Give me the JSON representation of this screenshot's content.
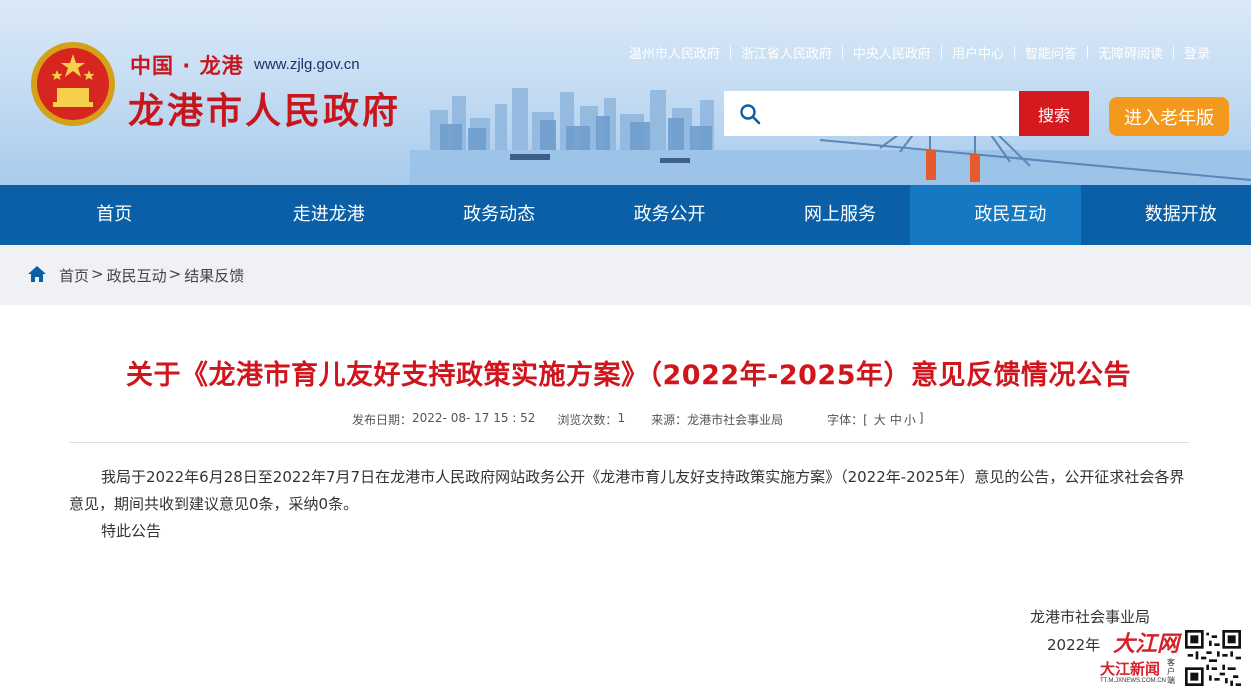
{
  "site": {
    "prefix": "中国 · 龙港",
    "url": "www.zjlg.gov.cn",
    "title": "龙港市人民政府"
  },
  "toplinks": [
    "温州市人民政府",
    "浙江省人民政府",
    "中央人民政府",
    "用户中心",
    "智能问答",
    "无障碍阅读",
    "登录"
  ],
  "search": {
    "placeholder": "",
    "button_label": "搜索"
  },
  "elder_button_label": "进入老年版",
  "nav": {
    "items": [
      "首页",
      "走进龙港",
      "政务动态",
      "政务公开",
      "网上服务",
      "政民互动",
      "数据开放"
    ],
    "active": "政民互动"
  },
  "breadcrumb": [
    "首页",
    "政民互动",
    "结果反馈"
  ],
  "article": {
    "title": "关于《龙港市育儿友好支持政策实施方案》（2022年-2025年）意见反馈情况公告",
    "meta": {
      "date_label": "发布日期：",
      "date": "2022- 08- 17 15 : 52",
      "views_label": "浏览次数：",
      "views": "1",
      "source_label": "来源：",
      "source": "龙港市社会事业局",
      "font_label": "字体：[",
      "font_large": "大",
      "font_medium": "中",
      "font_small": "小",
      "font_close": "]"
    },
    "paragraphs": [
      "我局于2022年6月28日至2022年7月7日在龙港市人民政府网站政务公开《龙港市育儿友好支持政策实施方案》（2022年-2025年）意见的公告，公开征求社会各界意见，期间共收到建议意见0条，采纳0条。",
      "特此公告"
    ],
    "signature_org": "龙港市社会事业局",
    "signature_date": "2022年"
  },
  "watermark": {
    "brand": "大江网",
    "news": "大江新闻",
    "url": "TT.M.JXNEWS.COM.CN",
    "client": "客户端"
  },
  "colors": {
    "primary_red": "#d0161d",
    "nav_blue": "#0a5fa7",
    "nav_active": "#1578c2",
    "elder_orange": "#f39a1e",
    "search_red": "#d41a1f"
  }
}
